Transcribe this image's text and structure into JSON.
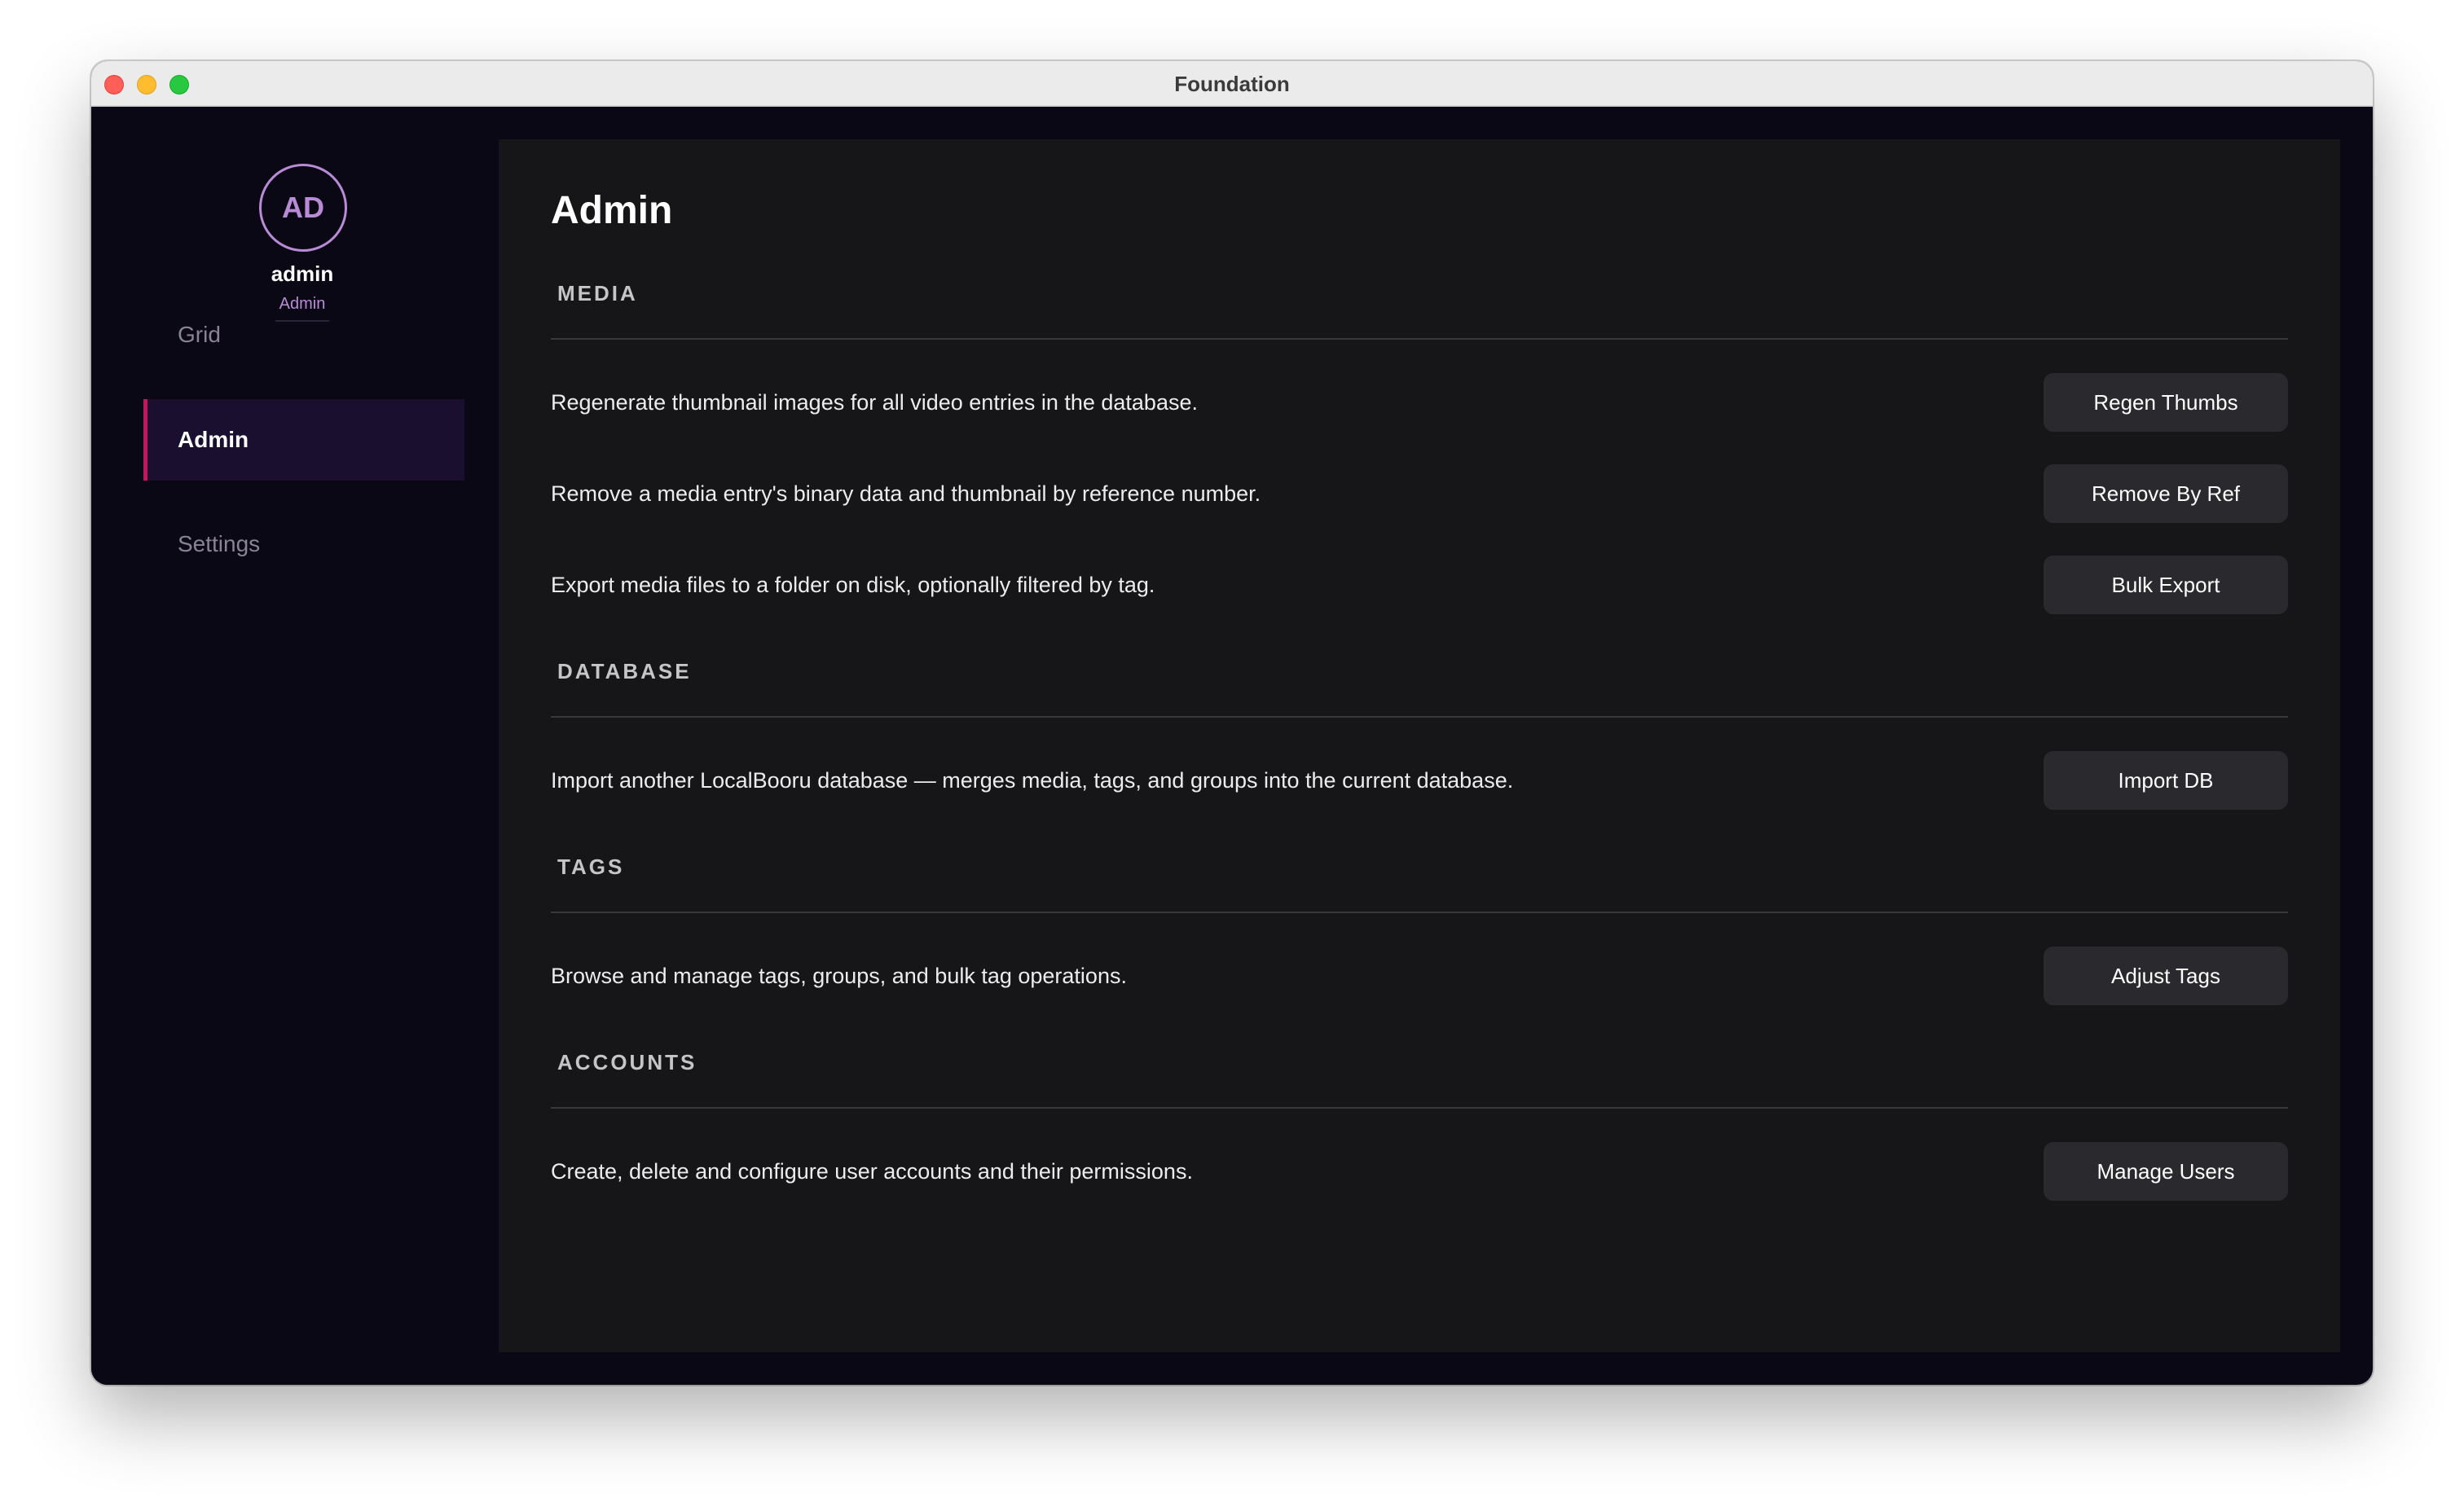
{
  "window": {
    "title": "Foundation"
  },
  "sidebar": {
    "avatar_initials": "AD",
    "username": "admin",
    "role": "Admin",
    "nav": [
      {
        "label": "Grid",
        "active": false
      },
      {
        "label": "Admin",
        "active": true
      },
      {
        "label": "Settings",
        "active": false
      }
    ]
  },
  "main": {
    "title": "Admin",
    "sections": [
      {
        "header": "MEDIA",
        "rows": [
          {
            "description": "Regenerate thumbnail images for all video entries in the database.",
            "button": "Regen Thumbs"
          },
          {
            "description": "Remove a media entry's binary data and thumbnail by reference number.",
            "button": "Remove By Ref"
          },
          {
            "description": "Export media files to a folder on disk, optionally filtered by tag.",
            "button": "Bulk Export"
          }
        ]
      },
      {
        "header": "DATABASE",
        "rows": [
          {
            "description": "Import another LocalBooru database — merges media, tags, and groups into the current database.",
            "button": "Import DB"
          }
        ]
      },
      {
        "header": "TAGS",
        "rows": [
          {
            "description": "Browse and manage tags, groups, and bulk tag operations.",
            "button": "Adjust Tags"
          }
        ]
      },
      {
        "header": "ACCOUNTS",
        "rows": [
          {
            "description": "Create, delete and configure user accounts and their permissions.",
            "button": "Manage Users"
          }
        ]
      }
    ]
  },
  "colors": {
    "sidebar_bg": "#0a0814",
    "main_bg": "#161618",
    "accent": "#b98bd6",
    "active_indicator": "#c2185b",
    "active_nav_bg": "#1a0f2e",
    "button_bg": "#2a2a2e"
  }
}
